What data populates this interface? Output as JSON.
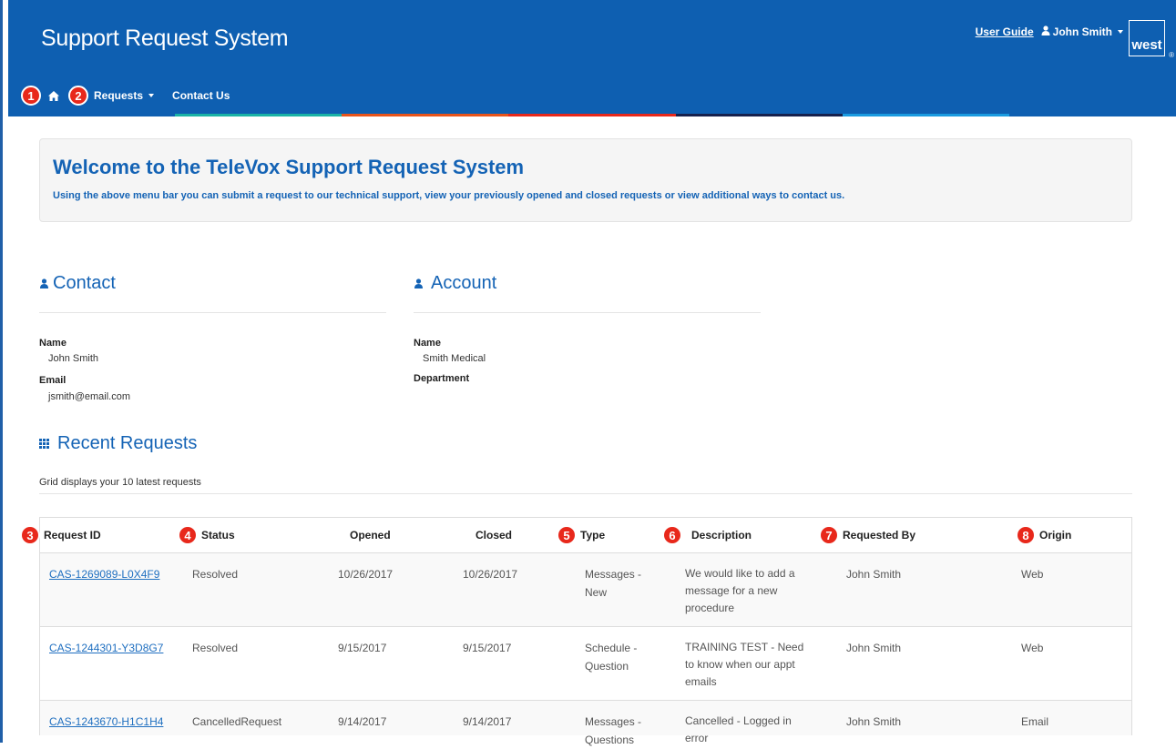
{
  "header": {
    "title": "Support Request System",
    "user_guide": "User Guide",
    "user_name": "John Smith",
    "logo_text": "west",
    "logo_mark": "®"
  },
  "nav": {
    "badges": [
      "1",
      "2"
    ],
    "requests": "Requests",
    "contact_us": "Contact Us",
    "bar_colors": [
      "#0e5fb1",
      "#1ab3a6",
      "#e8541b",
      "#e8281b",
      "#16214d",
      "#1a9be0",
      "#0e5fb1"
    ]
  },
  "welcome": {
    "title": "Welcome to the TeleVox Support Request System",
    "text": "Using the above menu bar you can submit a request to our technical support, view your previously opened and closed requests or view additional ways to contact us."
  },
  "contact": {
    "title": "Contact",
    "name_label": "Name",
    "name_value": "John Smith",
    "email_label": "Email",
    "email_value": "jsmith@email.com"
  },
  "account": {
    "title": "Account",
    "name_label": "Name",
    "name_value": "Smith Medical",
    "department_label": "Department"
  },
  "recent": {
    "title": "Recent Requests",
    "note": "Grid displays your 10 latest requests",
    "columns": [
      {
        "label": "Request ID",
        "badge": "3"
      },
      {
        "label": "Status",
        "badge": "4"
      },
      {
        "label": "Opened",
        "badge": ""
      },
      {
        "label": "Closed",
        "badge": ""
      },
      {
        "label": "Type",
        "badge": "5"
      },
      {
        "label": "Description",
        "badge": "6"
      },
      {
        "label": "Requested By",
        "badge": "7"
      },
      {
        "label": "Origin",
        "badge": "8"
      }
    ],
    "rows": [
      {
        "id": "CAS-1269089-L0X4F9",
        "status": "Resolved",
        "opened": "10/26/2017",
        "closed": "10/26/2017",
        "type_1": "Messages -",
        "type_2": "New",
        "desc_1": "We would like to add a",
        "desc_2": "message for a new",
        "desc_3": "procedure",
        "requested_by": "John Smith",
        "origin": "Web"
      },
      {
        "id": "CAS-1244301-Y3D8G7",
        "status": "Resolved",
        "opened": "9/15/2017",
        "closed": "9/15/2017",
        "type_1": "Schedule -",
        "type_2": "Question",
        "desc_1": "TRAINING TEST - Need",
        "desc_2": "to know when our appt",
        "desc_3": "emails",
        "requested_by": "John Smith",
        "origin": "Web"
      },
      {
        "id": "CAS-1243670-H1C1H4",
        "status": "CancelledRequest",
        "opened": "9/14/2017",
        "closed": "9/14/2017",
        "type_1": "Messages -",
        "type_2": "Questions",
        "desc_1": "Cancelled - Logged in",
        "desc_2": "error",
        "desc_3": "",
        "requested_by": "John Smith",
        "origin": "Email"
      }
    ]
  }
}
